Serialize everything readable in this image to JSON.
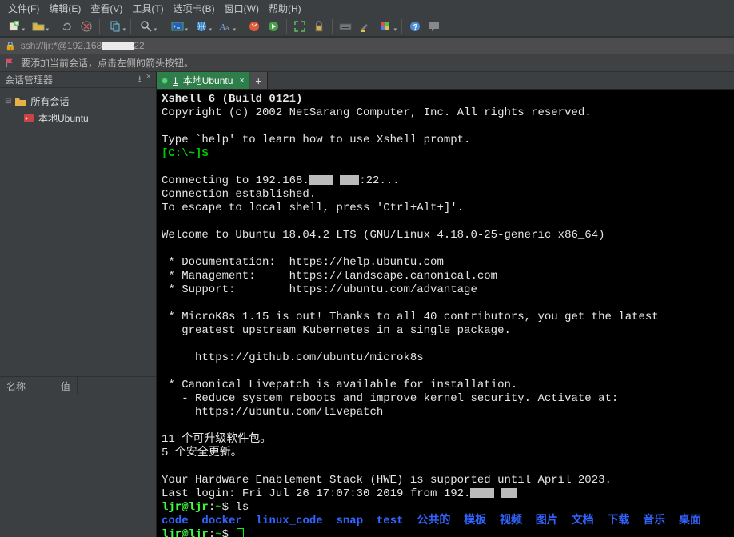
{
  "menu": {
    "file": "文件(F)",
    "edit": "编辑(E)",
    "view": "查看(V)",
    "tools": "工具(T)",
    "tabs": "选项卡(B)",
    "window": "窗口(W)",
    "help": "帮助(H)"
  },
  "toolbar": {
    "icons": [
      {
        "name": "new-session-icon",
        "dd": true
      },
      {
        "name": "open-icon",
        "dd": true
      },
      {
        "sep": true
      },
      {
        "name": "reconnect-icon"
      },
      {
        "name": "disconnect-icon"
      },
      {
        "sep": true
      },
      {
        "name": "copy-icon",
        "dd": true
      },
      {
        "sep": true
      },
      {
        "name": "find-icon",
        "dd": true
      },
      {
        "sep": true
      },
      {
        "name": "terminal-icon",
        "dd": true
      },
      {
        "name": "globe-icon",
        "dd": true
      },
      {
        "name": "font-icon",
        "dd": true
      },
      {
        "sep": true
      },
      {
        "name": "script-stop-icon"
      },
      {
        "name": "script-run-icon"
      },
      {
        "sep": true
      },
      {
        "name": "fullscreen-icon"
      },
      {
        "name": "lock-icon"
      },
      {
        "sep": true
      },
      {
        "name": "keyboard-icon"
      },
      {
        "name": "highlight-icon"
      },
      {
        "name": "palette-icon",
        "dd": true
      },
      {
        "sep": true
      },
      {
        "name": "help-icon"
      },
      {
        "name": "chat-icon"
      }
    ]
  },
  "addressbar": {
    "prefix": "ssh://ljr:*@192.168",
    "suffix": "22"
  },
  "infobar": {
    "text": "要添加当前会话，点击左侧的箭头按钮。"
  },
  "sidebar": {
    "title": "会话管理器",
    "pin": "⭳",
    "close": "×",
    "tree": {
      "root_caret": "⊟",
      "root_label": "所有会话",
      "child_label": "本地Ubuntu"
    },
    "props": {
      "col1": "名称",
      "col2": "值"
    }
  },
  "tabbar": {
    "tab1_prefix": "1",
    "tab1_label": "本地Ubuntu",
    "tab1_close": "×",
    "add": "+"
  },
  "terminal_lines": {
    "l01": "Xshell 6 (Build 0121)",
    "l02": "Copyright (c) 2002 NetSarang Computer, Inc. All rights reserved.",
    "l03": "",
    "l04": "Type `help' to learn how to use Xshell prompt.",
    "l05": "[C:\\~]$",
    "l06": "",
    "l07a": "Connecting to 192.168.",
    "l07b": ":22...",
    "l08": "Connection established.",
    "l09": "To escape to local shell, press 'Ctrl+Alt+]'.",
    "l10": "",
    "l11": "Welcome to Ubuntu 18.04.2 LTS (GNU/Linux 4.18.0-25-generic x86_64)",
    "l12": "",
    "l13": " * Documentation:  https://help.ubuntu.com",
    "l14": " * Management:     https://landscape.canonical.com",
    "l15": " * Support:        https://ubuntu.com/advantage",
    "l16": "",
    "l17": " * MicroK8s 1.15 is out! Thanks to all 40 contributors, you get the latest",
    "l18": "   greatest upstream Kubernetes in a single package.",
    "l19": "",
    "l20": "     https://github.com/ubuntu/microk8s",
    "l21": "",
    "l22": " * Canonical Livepatch is available for installation.",
    "l23": "   - Reduce system reboots and improve kernel security. Activate at:",
    "l24": "     https://ubuntu.com/livepatch",
    "l25": "",
    "l26": "11 个可升级软件包。",
    "l27": "5 个安全更新。",
    "l28": "",
    "l29": "Your Hardware Enablement Stack (HWE) is supported until April 2023.",
    "l30a": "Last login: Fri Jul 26 17:07:30 2019 from 192.",
    "ps1_a": "ljr@ljr",
    "ps1_b": ":",
    "ps1_c": "~",
    "ps1_d": "$ ",
    "cmd_ls": "ls",
    "dirs": {
      "d0": "code",
      "d1": "docker",
      "d2": "linux_code",
      "d3": "snap",
      "d4": "test",
      "d5": "公共的",
      "d6": "模板",
      "d7": "视频",
      "d8": "图片",
      "d9": "文档",
      "d10": "下载",
      "d11": "音乐",
      "d12": "桌面"
    }
  }
}
